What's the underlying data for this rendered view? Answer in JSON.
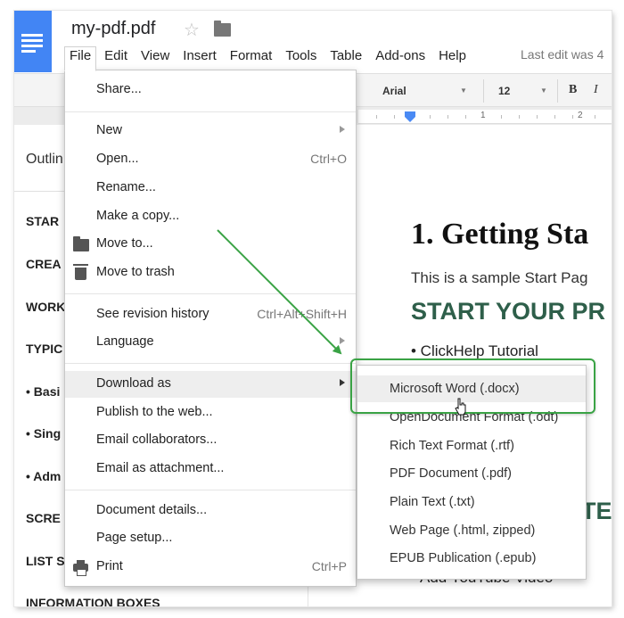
{
  "header": {
    "doc_title": "my-pdf.pdf",
    "star_icon": "star-outline-icon",
    "folder_icon": "folder-icon",
    "last_edit": "Last edit was 4"
  },
  "menubar": [
    "File",
    "Edit",
    "View",
    "Insert",
    "Format",
    "Tools",
    "Table",
    "Add-ons",
    "Help"
  ],
  "toolbar": {
    "font": "Arial",
    "size": "12",
    "bold": "B",
    "italic": "I"
  },
  "ruler": {
    "marks": [
      "1",
      "2"
    ]
  },
  "outline": {
    "title": "Outlin",
    "items": [
      "STAR",
      "CREA",
      "WORK",
      "TYPIC",
      "• Basi",
      "• Sing",
      "• Adm",
      "SCRE",
      "LIST S",
      "INFORMATION BOXES"
    ]
  },
  "document": {
    "heading1": "1. Getting Sta",
    "para1": "This is a sample Start Pag",
    "heading2": "START YOUR PR",
    "bullet1": "• ClickHelp Tutorial",
    "heading2b": "TE",
    "bullet2": "Add YouTube Video"
  },
  "file_menu": {
    "share": "Share...",
    "new": "New",
    "open": "Open...",
    "open_shortcut": "Ctrl+O",
    "rename": "Rename...",
    "make_copy": "Make a copy...",
    "move_to": "Move to...",
    "move_to_trash": "Move to trash",
    "see_revision": "See revision history",
    "see_revision_shortcut": "Ctrl+Alt+Shift+H",
    "language": "Language",
    "download_as": "Download as",
    "publish": "Publish to the web...",
    "email_collab": "Email collaborators...",
    "email_attach": "Email as attachment...",
    "doc_details": "Document details...",
    "page_setup": "Page setup...",
    "print": "Print",
    "print_shortcut": "Ctrl+P"
  },
  "download_submenu": [
    "Microsoft Word (.docx)",
    "OpenDocument Format (.odt)",
    "Rich Text Format (.rtf)",
    "PDF Document (.pdf)",
    "Plain Text (.txt)",
    "Web Page (.html, zipped)",
    "EPUB Publication (.epub)"
  ],
  "colors": {
    "accent": "#4285f4",
    "annotation": "#3aa345",
    "heading": "#2e5f4a"
  }
}
